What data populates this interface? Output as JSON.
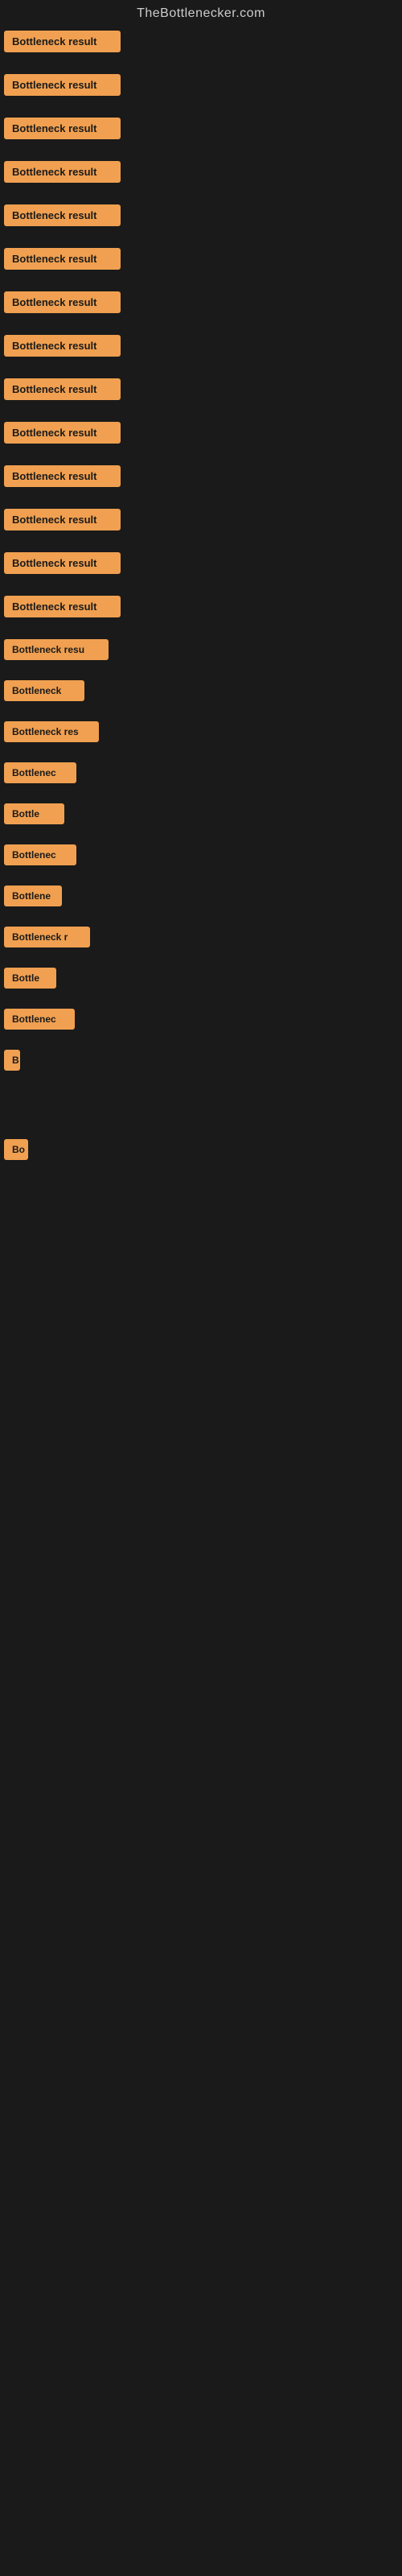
{
  "site": {
    "title": "TheBottlenecker.com"
  },
  "items": [
    {
      "id": 0,
      "label": "Bottleneck result"
    },
    {
      "id": 1,
      "label": "Bottleneck result"
    },
    {
      "id": 2,
      "label": "Bottleneck result"
    },
    {
      "id": 3,
      "label": "Bottleneck result"
    },
    {
      "id": 4,
      "label": "Bottleneck result"
    },
    {
      "id": 5,
      "label": "Bottleneck result"
    },
    {
      "id": 6,
      "label": "Bottleneck result"
    },
    {
      "id": 7,
      "label": "Bottleneck result"
    },
    {
      "id": 8,
      "label": "Bottleneck result"
    },
    {
      "id": 9,
      "label": "Bottleneck result"
    },
    {
      "id": 10,
      "label": "Bottleneck result"
    },
    {
      "id": 11,
      "label": "Bottleneck result"
    },
    {
      "id": 12,
      "label": "Bottleneck result"
    },
    {
      "id": 13,
      "label": "Bottleneck result"
    },
    {
      "id": 14,
      "label": "Bottleneck resu"
    },
    {
      "id": 15,
      "label": "Bottleneck"
    },
    {
      "id": 16,
      "label": "Bottleneck res"
    },
    {
      "id": 17,
      "label": "Bottlenec"
    },
    {
      "id": 18,
      "label": "Bottle"
    },
    {
      "id": 19,
      "label": "Bottlenec"
    },
    {
      "id": 20,
      "label": "Bottlene"
    },
    {
      "id": 21,
      "label": "Bottleneck r"
    },
    {
      "id": 22,
      "label": "Bottle"
    },
    {
      "id": 23,
      "label": "Bottlenec"
    },
    {
      "id": 24,
      "label": "B"
    },
    {
      "id": 25,
      "label": ""
    },
    {
      "id": 26,
      "label": ""
    },
    {
      "id": 27,
      "label": ""
    },
    {
      "id": 28,
      "label": ""
    },
    {
      "id": 29,
      "label": "Bo"
    },
    {
      "id": 30,
      "label": ""
    },
    {
      "id": 31,
      "label": ""
    },
    {
      "id": 32,
      "label": ""
    },
    {
      "id": 33,
      "label": ""
    },
    {
      "id": 34,
      "label": ""
    }
  ]
}
